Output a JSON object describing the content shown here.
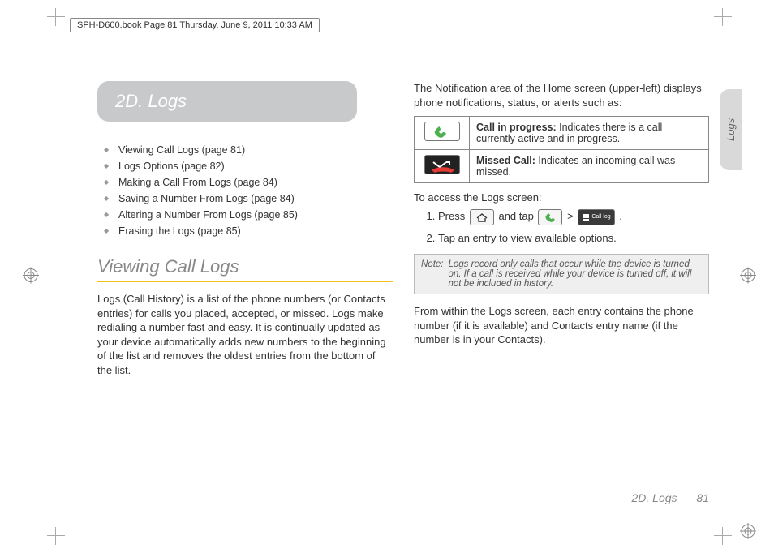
{
  "doc_header": "SPH-D600.book  Page 81  Thursday, June 9, 2011  10:33 AM",
  "section_title": "2D. Logs",
  "toc": [
    "Viewing Call Logs (page 81)",
    "Logs Options (page 82)",
    "Making a Call From Logs (page 84)",
    "Saving a Number From Logs (page 84)",
    "Altering a Number From Logs (page 85)",
    "Erasing the Logs (page 85)"
  ],
  "h2_viewing": "Viewing Call Logs",
  "para_viewing": "Logs (Call History) is a list of the phone numbers (or Contacts entries) for calls you placed, accepted, or missed. Logs make redialing a number fast and easy. It is continually updated as your device automatically adds new numbers to the beginning of the list and removes the oldest entries from the bottom of the list.",
  "para_notif_intro": "The Notification area of the Home screen (upper-left) displays phone notifications, status, or alerts such as:",
  "notifications": [
    {
      "label": "Call in progress:",
      "desc": " Indicates there is a call currently active and in progress."
    },
    {
      "label": "Missed Call:",
      "desc": " Indicates an incoming call was missed."
    }
  ],
  "access_head": "To access the Logs screen:",
  "steps": {
    "s1a": "Press ",
    "s1b": " and tap ",
    "s1c": " > ",
    "s1d": ".",
    "s2": "Tap an entry to view available options."
  },
  "call_log_label": "Call log",
  "note": {
    "label": "Note:",
    "text": "Logs record only calls that occur while the device is turned on. If a call is received while your device is turned off, it will not be included in history."
  },
  "para_after": "From within the Logs screen, each entry contains the phone number (if it is available) and Contacts entry name (if the number is in your Contacts).",
  "side_tab": "Logs",
  "footer_title": "2D. Logs",
  "footer_page": "81"
}
